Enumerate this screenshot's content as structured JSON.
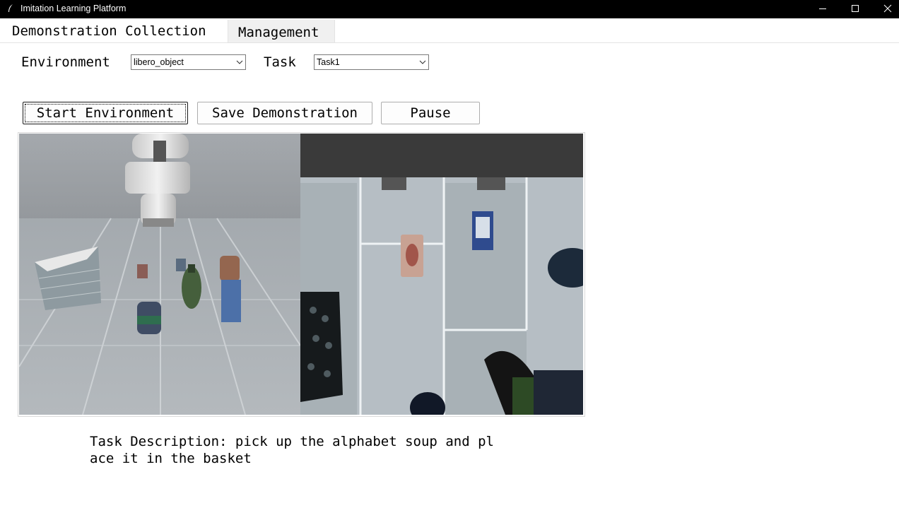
{
  "window": {
    "title": "Imitation Learning Platform"
  },
  "tabs": [
    {
      "label": "Demonstration Collection"
    },
    {
      "label": "Management"
    }
  ],
  "form": {
    "environment_label": "Environment",
    "environment_value": "libero_object",
    "task_label": "Task",
    "task_value": "Task1"
  },
  "buttons": {
    "start": "Start Environment",
    "save": "Save Demonstration",
    "pause": "Pause"
  },
  "task_description": "Task Description: pick up the alphabet soup and pl\nace it in the basket"
}
